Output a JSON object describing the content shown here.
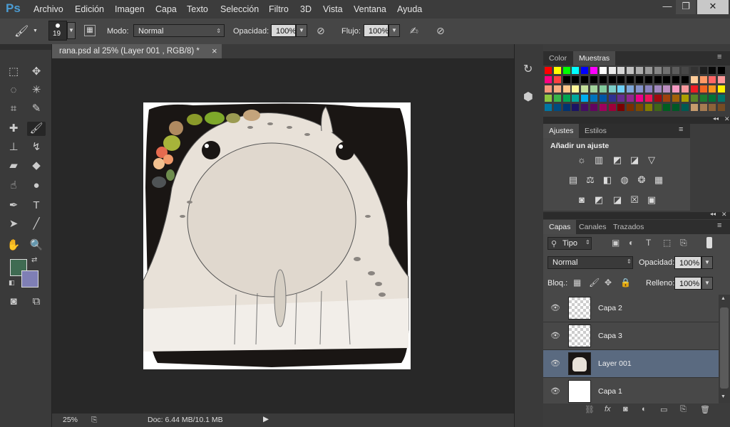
{
  "app": {
    "logo": "Ps"
  },
  "menu": [
    "Archivo",
    "Edición",
    "Imagen",
    "Capa",
    "Texto",
    "Selección",
    "Filtro",
    "3D",
    "Vista",
    "Ventana",
    "Ayuda"
  ],
  "window_controls": {
    "minimize": "—",
    "restore": "❐",
    "close": "✕"
  },
  "options": {
    "brush_size": "19",
    "mode_label": "Modo:",
    "mode_value": "Normal",
    "opacity_label": "Opacidad:",
    "opacity_value": "100%",
    "flow_label": "Flujo:",
    "flow_value": "100%"
  },
  "colors": {
    "foreground": "#3f6b52",
    "background": "#7f7fb5",
    "accent": "#4b9cd3"
  },
  "document": {
    "tab_title": "rana.psd al 25% (Layer 001       , RGB/8) *",
    "close": "×",
    "zoom": "25%",
    "doc_info": "Doc: 6.44 MB/10.1 MB"
  },
  "swatch_panel": {
    "tabs": [
      "Color",
      "Muestras"
    ],
    "rows": [
      [
        "#ff0000",
        "#ffff00",
        "#00ff00",
        "#00ffff",
        "#0000ff",
        "#ff00ff",
        "#ffffff",
        "#ebebeb",
        "#d6d6d6",
        "#c2c2c2",
        "#adadad",
        "#999999",
        "#858585",
        "#707070",
        "#5c5c5c",
        "#474747",
        "#333333",
        "#1f1f1f",
        "#0a0a0a",
        "#000000"
      ],
      [
        "#ff0080",
        "#ff4040",
        "#000000",
        "#000000",
        "#000000",
        "#000000",
        "#000000",
        "#000000",
        "#000000",
        "#000000",
        "#000000",
        "#000000",
        "#000000",
        "#000000",
        "#000000",
        "#000000",
        "#ffcc99",
        "#ff9966",
        "#ff6666",
        "#ff9999"
      ],
      [
        "#f7977a",
        "#f9ad81",
        "#fdc68a",
        "#fff79a",
        "#c4df9b",
        "#a2d39c",
        "#82ca9d",
        "#7bcdc8",
        "#6ecff6",
        "#7ea7d8",
        "#8493ca",
        "#8882be",
        "#a187be",
        "#bc8dbf",
        "#f49ac2",
        "#f6989d",
        "#ed1c24",
        "#f26522",
        "#f7941d",
        "#fff200"
      ],
      [
        "#8dc63f",
        "#39b54a",
        "#00a651",
        "#00a99d",
        "#00aeef",
        "#0072bc",
        "#0054a6",
        "#2e3192",
        "#662d91",
        "#92278f",
        "#ec008c",
        "#ed145b",
        "#9e0b0f",
        "#a0410d",
        "#a36209",
        "#aba000",
        "#598527",
        "#1a7b30",
        "#007236",
        "#00746b"
      ],
      [
        "#0076a3",
        "#004b80",
        "#003471",
        "#1b1464",
        "#440e62",
        "#630460",
        "#9e005d",
        "#9e0039",
        "#790000",
        "#7b2e00",
        "#7d4900",
        "#827b00",
        "#406618",
        "#005e20",
        "#005826",
        "#005952",
        "#c69c6d",
        "#a67c52",
        "#8c6239",
        "#754c24"
      ]
    ]
  },
  "adjust_panel": {
    "tabs": [
      "Ajustes",
      "Estilos"
    ],
    "title": "Añadir un ajuste",
    "icons": [
      "brightness-icon",
      "levels-icon",
      "curves-icon",
      "exposure-icon",
      "vibrance-icon",
      "hue-saturation-icon",
      "color-balance-icon",
      "black-white-icon",
      "photo-filter-icon",
      "channel-mixer-icon",
      "color-lookup-icon",
      "invert-icon",
      "posterize-icon",
      "threshold-icon",
      "gradient-map-icon",
      "selective-color-icon"
    ]
  },
  "layers_panel": {
    "tabs": [
      "Capas",
      "Canales",
      "Trazados"
    ],
    "filter_label": "Tipo",
    "blend_mode": "Normal",
    "opacity_label": "Opacidad:",
    "opacity_value": "100%",
    "lock_label": "Bloq.:",
    "fill_label": "Relleno:",
    "fill_value": "100%",
    "layers": [
      {
        "name": "Capa 2",
        "selected": false
      },
      {
        "name": "Capa 3",
        "selected": false
      },
      {
        "name": "Layer 001",
        "selected": true
      },
      {
        "name": "Capa 1",
        "selected": false
      }
    ]
  }
}
